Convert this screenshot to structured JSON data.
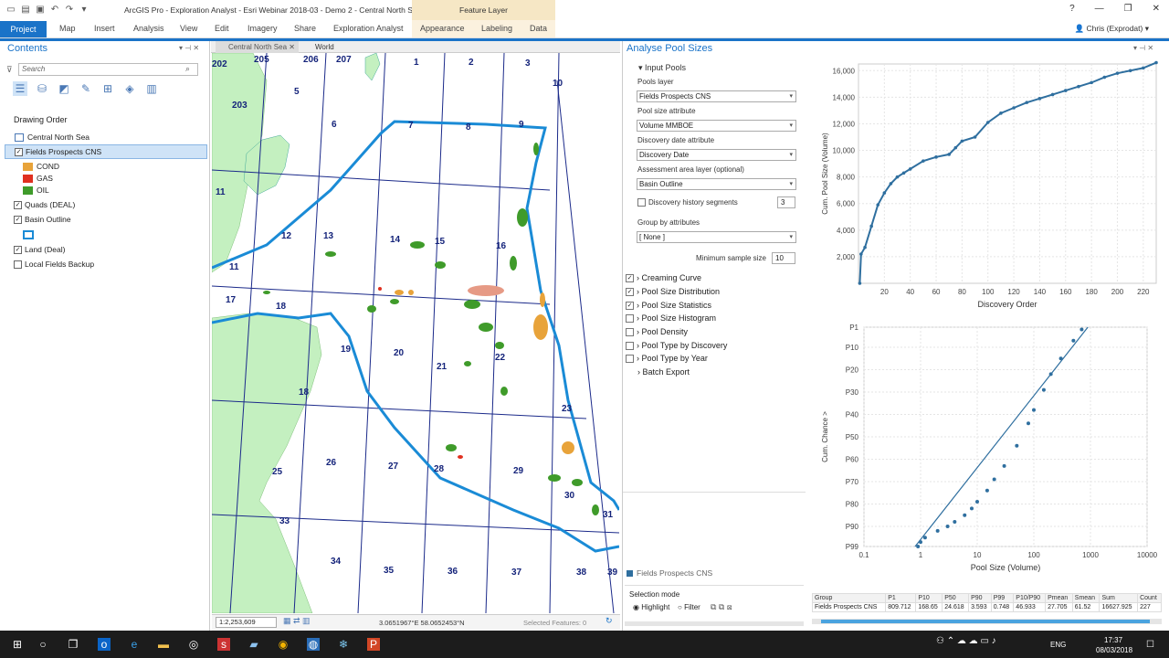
{
  "window": {
    "title": "ArcGIS Pro - Exploration Analyst - Esri Webinar 2018-03 - Demo 2 - Central North Sea",
    "feature_layer_label": "Feature Layer",
    "help": "?",
    "user": "Chris (Exprodat)"
  },
  "ribbon": {
    "tabs": [
      "Project",
      "Map",
      "Insert",
      "Analysis",
      "View",
      "Edit",
      "Imagery",
      "Share",
      "Exploration Analyst",
      "Appearance",
      "Labeling",
      "Data"
    ]
  },
  "contents": {
    "title": "Contents",
    "search_placeholder": "Search",
    "drawing_order": "Drawing Order",
    "map_name": "Central North Sea",
    "layers": [
      {
        "name": "Fields Prospects CNS",
        "checked": true
      },
      {
        "name": "Quads (DEAL)",
        "checked": true
      },
      {
        "name": "Basin Outline",
        "checked": true
      },
      {
        "name": "Land (Deal)",
        "checked": true
      },
      {
        "name": "Local Fields Backup",
        "checked": false
      }
    ],
    "legend": [
      {
        "label": "COND",
        "color": "#e8a33a"
      },
      {
        "label": "GAS",
        "color": "#e03020"
      },
      {
        "label": "OIL",
        "color": "#3f9b2a"
      }
    ]
  },
  "map": {
    "tabs": [
      "Central North Sea",
      "World"
    ],
    "scale": "1:2,253,609",
    "coords": "3.0651967°E 58.0652453°N",
    "selected": "Selected Features: 0",
    "labels": [
      "202",
      "205",
      "206",
      "207",
      "1",
      "2",
      "3",
      "10",
      "5",
      "203",
      "6",
      "7",
      "8",
      "9",
      "11",
      "12",
      "13",
      "14",
      "15",
      "16",
      "11",
      "17",
      "18",
      "19",
      "20",
      "21",
      "22",
      "23",
      "18",
      "25",
      "26",
      "27",
      "28",
      "29",
      "30",
      "31",
      "33",
      "34",
      "35",
      "36",
      "37",
      "38",
      "39"
    ]
  },
  "analyse": {
    "title": "Analyse Pool Sizes",
    "input_pools": "Input Pools",
    "pools_layer_label": "Pools layer",
    "pools_layer_value": "Fields Prospects CNS",
    "pool_size_attr_label": "Pool size attribute",
    "pool_size_attr_value": "Volume MMBOE",
    "discovery_date_label": "Discovery date attribute",
    "discovery_date_value": "Discovery Date",
    "assessment_label": "Assessment area layer (optional)",
    "assessment_value": "Basin Outline",
    "discovery_history_label": "Discovery history segments",
    "discovery_history_value": "3",
    "group_by_label": "Group by attributes",
    "group_by_value": "[ None ]",
    "min_sample_label": "Minimum sample size",
    "min_sample_value": "10",
    "options": [
      {
        "label": "Creaming Curve",
        "checked": true
      },
      {
        "label": "Pool Size Distribution",
        "checked": true
      },
      {
        "label": "Pool Size Statistics",
        "checked": true
      },
      {
        "label": "Pool Size Histogram",
        "checked": false
      },
      {
        "label": "Pool Density",
        "checked": false
      },
      {
        "label": "Pool Type by Discovery",
        "checked": false
      },
      {
        "label": "Pool Type by Year",
        "checked": false
      }
    ],
    "batch_export": "Batch Export",
    "legend_item": "Fields Prospects CNS",
    "selection_mode": "Selection mode",
    "highlight": "Highlight",
    "filter": "Filter"
  },
  "chart_data": [
    {
      "type": "line",
      "xlabel": "Discovery Order",
      "ylabel": "Cum. Pool Size (Volume)",
      "xlim": [
        0,
        230
      ],
      "ylim": [
        0,
        16500
      ],
      "xticks": [
        20,
        40,
        60,
        80,
        100,
        120,
        140,
        160,
        180,
        200,
        220
      ],
      "yticks": [
        2000,
        4000,
        6000,
        8000,
        10000,
        12000,
        14000,
        16000
      ],
      "ytick_labels": [
        "2,000",
        "4,000",
        "6,000",
        "8,000",
        "10,000",
        "12,000",
        "14,000",
        "16,000"
      ],
      "x": [
        1,
        2,
        5,
        10,
        15,
        20,
        25,
        30,
        35,
        40,
        50,
        60,
        70,
        75,
        80,
        90,
        100,
        110,
        120,
        130,
        140,
        150,
        160,
        170,
        180,
        190,
        200,
        210,
        220,
        230
      ],
      "y": [
        0,
        2200,
        2700,
        4300,
        5900,
        6800,
        7500,
        8000,
        8300,
        8600,
        9200,
        9500,
        9700,
        10200,
        10700,
        11000,
        12100,
        12800,
        13200,
        13600,
        13900,
        14200,
        14500,
        14800,
        15100,
        15500,
        15800,
        16000,
        16200,
        16600
      ],
      "color": "#2f6f9f"
    },
    {
      "type": "scatter",
      "xlabel": "Pool Size (Volume)",
      "ylabel": "Cum. Chance >",
      "x_scale": "log",
      "xticks": [
        0.1,
        1,
        10,
        100,
        1000,
        10000
      ],
      "xtick_labels": [
        "0.1",
        "1",
        "10",
        "100",
        "1000",
        "10000"
      ],
      "yticks": [
        "P1",
        "P10",
        "P20",
        "P30",
        "P40",
        "P50",
        "P60",
        "P70",
        "P80",
        "P90",
        "P99"
      ],
      "x": [
        0.9,
        1,
        1.2,
        2,
        3,
        4,
        6,
        8,
        10,
        15,
        20,
        30,
        50,
        80,
        100,
        150,
        200,
        300,
        500,
        700
      ],
      "y": [
        99,
        97,
        95,
        92,
        90,
        88,
        85,
        82,
        79,
        74,
        69,
        63,
        54,
        44,
        38,
        29,
        22,
        15,
        7,
        2
      ],
      "color": "#2f6f9f"
    }
  ],
  "stats_table": {
    "headers": [
      "Group",
      "P1",
      "P10",
      "P50",
      "P90",
      "P99",
      "P10/P90",
      "Pmean",
      "Smean",
      "Sum",
      "Count"
    ],
    "rows": [
      [
        "Fields Prospects CNS",
        "809.712",
        "168.65",
        "24.618",
        "3.593",
        "0.748",
        "46.933",
        "27.705",
        "61.52",
        "16627.925",
        "227"
      ]
    ]
  },
  "taskbar": {
    "lang": "ENG",
    "time": "17:37",
    "date": "08/03/2018"
  }
}
